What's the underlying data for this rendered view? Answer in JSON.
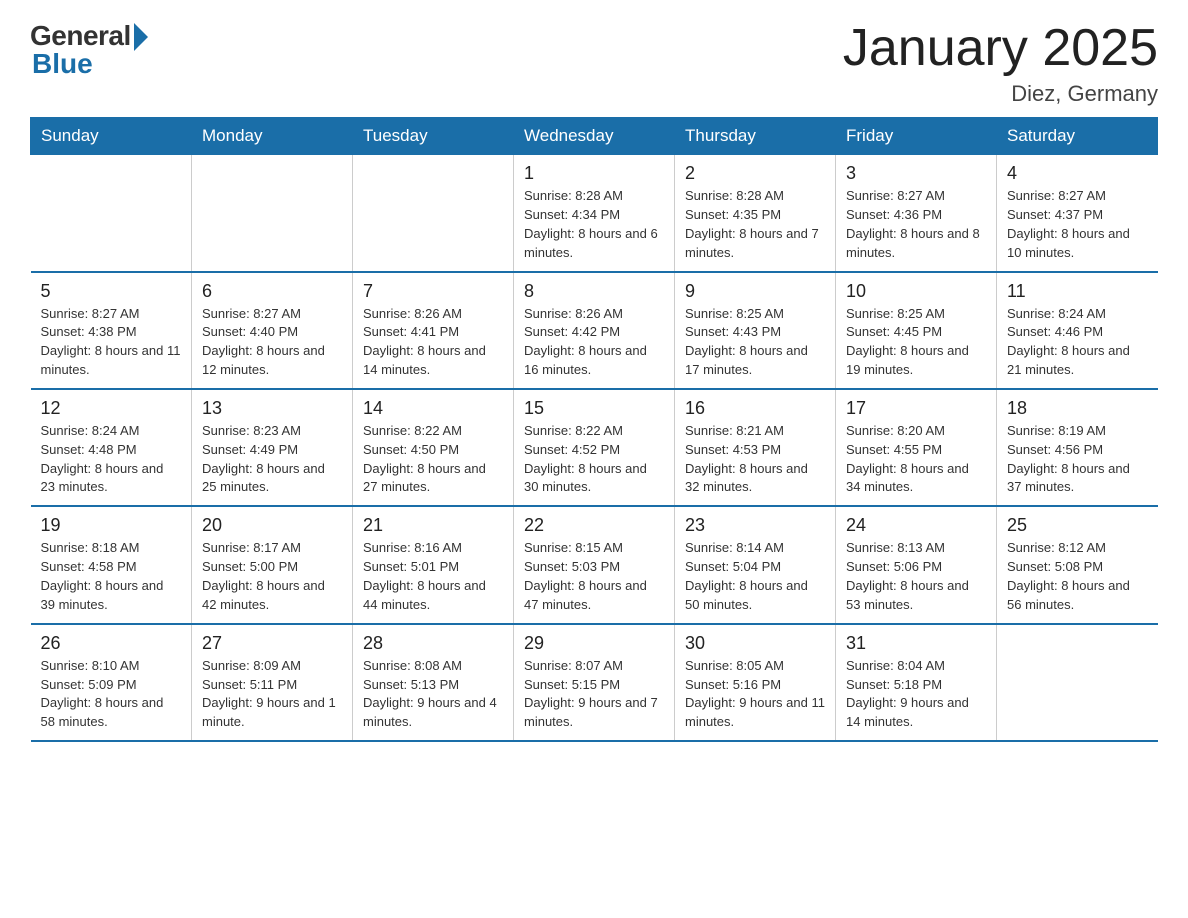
{
  "logo": {
    "general": "General",
    "blue": "Blue"
  },
  "title": "January 2025",
  "location": "Diez, Germany",
  "days_of_week": [
    "Sunday",
    "Monday",
    "Tuesday",
    "Wednesday",
    "Thursday",
    "Friday",
    "Saturday"
  ],
  "weeks": [
    [
      {
        "day": "",
        "info": ""
      },
      {
        "day": "",
        "info": ""
      },
      {
        "day": "",
        "info": ""
      },
      {
        "day": "1",
        "info": "Sunrise: 8:28 AM\nSunset: 4:34 PM\nDaylight: 8 hours and 6 minutes."
      },
      {
        "day": "2",
        "info": "Sunrise: 8:28 AM\nSunset: 4:35 PM\nDaylight: 8 hours and 7 minutes."
      },
      {
        "day": "3",
        "info": "Sunrise: 8:27 AM\nSunset: 4:36 PM\nDaylight: 8 hours and 8 minutes."
      },
      {
        "day": "4",
        "info": "Sunrise: 8:27 AM\nSunset: 4:37 PM\nDaylight: 8 hours and 10 minutes."
      }
    ],
    [
      {
        "day": "5",
        "info": "Sunrise: 8:27 AM\nSunset: 4:38 PM\nDaylight: 8 hours and 11 minutes."
      },
      {
        "day": "6",
        "info": "Sunrise: 8:27 AM\nSunset: 4:40 PM\nDaylight: 8 hours and 12 minutes."
      },
      {
        "day": "7",
        "info": "Sunrise: 8:26 AM\nSunset: 4:41 PM\nDaylight: 8 hours and 14 minutes."
      },
      {
        "day": "8",
        "info": "Sunrise: 8:26 AM\nSunset: 4:42 PM\nDaylight: 8 hours and 16 minutes."
      },
      {
        "day": "9",
        "info": "Sunrise: 8:25 AM\nSunset: 4:43 PM\nDaylight: 8 hours and 17 minutes."
      },
      {
        "day": "10",
        "info": "Sunrise: 8:25 AM\nSunset: 4:45 PM\nDaylight: 8 hours and 19 minutes."
      },
      {
        "day": "11",
        "info": "Sunrise: 8:24 AM\nSunset: 4:46 PM\nDaylight: 8 hours and 21 minutes."
      }
    ],
    [
      {
        "day": "12",
        "info": "Sunrise: 8:24 AM\nSunset: 4:48 PM\nDaylight: 8 hours and 23 minutes."
      },
      {
        "day": "13",
        "info": "Sunrise: 8:23 AM\nSunset: 4:49 PM\nDaylight: 8 hours and 25 minutes."
      },
      {
        "day": "14",
        "info": "Sunrise: 8:22 AM\nSunset: 4:50 PM\nDaylight: 8 hours and 27 minutes."
      },
      {
        "day": "15",
        "info": "Sunrise: 8:22 AM\nSunset: 4:52 PM\nDaylight: 8 hours and 30 minutes."
      },
      {
        "day": "16",
        "info": "Sunrise: 8:21 AM\nSunset: 4:53 PM\nDaylight: 8 hours and 32 minutes."
      },
      {
        "day": "17",
        "info": "Sunrise: 8:20 AM\nSunset: 4:55 PM\nDaylight: 8 hours and 34 minutes."
      },
      {
        "day": "18",
        "info": "Sunrise: 8:19 AM\nSunset: 4:56 PM\nDaylight: 8 hours and 37 minutes."
      }
    ],
    [
      {
        "day": "19",
        "info": "Sunrise: 8:18 AM\nSunset: 4:58 PM\nDaylight: 8 hours and 39 minutes."
      },
      {
        "day": "20",
        "info": "Sunrise: 8:17 AM\nSunset: 5:00 PM\nDaylight: 8 hours and 42 minutes."
      },
      {
        "day": "21",
        "info": "Sunrise: 8:16 AM\nSunset: 5:01 PM\nDaylight: 8 hours and 44 minutes."
      },
      {
        "day": "22",
        "info": "Sunrise: 8:15 AM\nSunset: 5:03 PM\nDaylight: 8 hours and 47 minutes."
      },
      {
        "day": "23",
        "info": "Sunrise: 8:14 AM\nSunset: 5:04 PM\nDaylight: 8 hours and 50 minutes."
      },
      {
        "day": "24",
        "info": "Sunrise: 8:13 AM\nSunset: 5:06 PM\nDaylight: 8 hours and 53 minutes."
      },
      {
        "day": "25",
        "info": "Sunrise: 8:12 AM\nSunset: 5:08 PM\nDaylight: 8 hours and 56 minutes."
      }
    ],
    [
      {
        "day": "26",
        "info": "Sunrise: 8:10 AM\nSunset: 5:09 PM\nDaylight: 8 hours and 58 minutes."
      },
      {
        "day": "27",
        "info": "Sunrise: 8:09 AM\nSunset: 5:11 PM\nDaylight: 9 hours and 1 minute."
      },
      {
        "day": "28",
        "info": "Sunrise: 8:08 AM\nSunset: 5:13 PM\nDaylight: 9 hours and 4 minutes."
      },
      {
        "day": "29",
        "info": "Sunrise: 8:07 AM\nSunset: 5:15 PM\nDaylight: 9 hours and 7 minutes."
      },
      {
        "day": "30",
        "info": "Sunrise: 8:05 AM\nSunset: 5:16 PM\nDaylight: 9 hours and 11 minutes."
      },
      {
        "day": "31",
        "info": "Sunrise: 8:04 AM\nSunset: 5:18 PM\nDaylight: 9 hours and 14 minutes."
      },
      {
        "day": "",
        "info": ""
      }
    ]
  ]
}
